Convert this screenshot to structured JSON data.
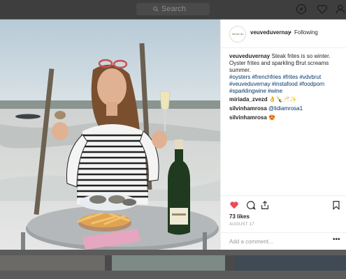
{
  "topbar": {
    "search_placeholder": "Search"
  },
  "post": {
    "avatar_text": "Veuve du Vernay",
    "username": "veuveduvernay",
    "dot": "•",
    "follow_label": "Following",
    "caption_user": "veuveduvernay",
    "caption_text": " Steak frites is so winter. Oyster frites and sparkling Brut screams summer.",
    "hashtags": "#oysters #frenchfries #frites #vdvbrut #veuveduvernay #instafood #foodporn #sparklingwine #wine",
    "comments": [
      {
        "user": "miriada_zvezd",
        "text": " 👌🍾🥂✨"
      },
      {
        "user": "silvinhamrosa",
        "text": " @lidiamrosa1"
      },
      {
        "user": "silvinhamrosa",
        "text": " 😍"
      }
    ],
    "likes": "73 likes",
    "date": "AUGUST 17",
    "add_comment_placeholder": "Add a comment...",
    "more": "•••"
  },
  "colors": {
    "like_heart": "#ed4956",
    "hashtag": "#003569"
  },
  "icons": [
    "search-icon",
    "compass-icon",
    "heart-icon",
    "profile-icon",
    "like-heart-icon",
    "comment-icon",
    "share-icon",
    "bookmark-icon"
  ]
}
